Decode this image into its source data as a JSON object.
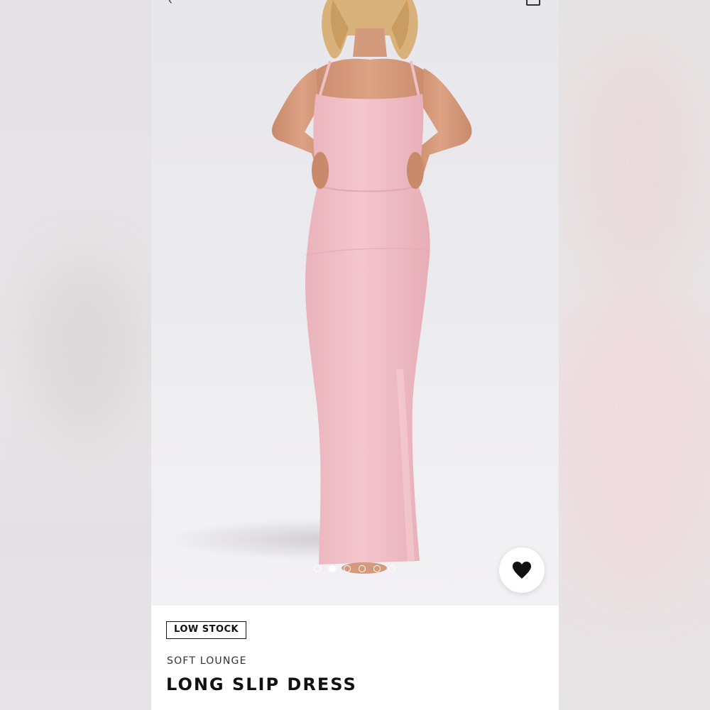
{
  "product": {
    "stock_badge": "LOW STOCK",
    "brand": "SOFT LOUNGE",
    "name": "LONG SLIP DRESS",
    "dress_color": "#f2c2c9"
  },
  "gallery": {
    "image_count": 6,
    "active_index": 1
  },
  "icons": {
    "back": "back-arrow-icon",
    "share": "share-icon",
    "favorite": "heart-icon"
  },
  "colors": {
    "accent": "#111111",
    "background": "#ffffff"
  }
}
